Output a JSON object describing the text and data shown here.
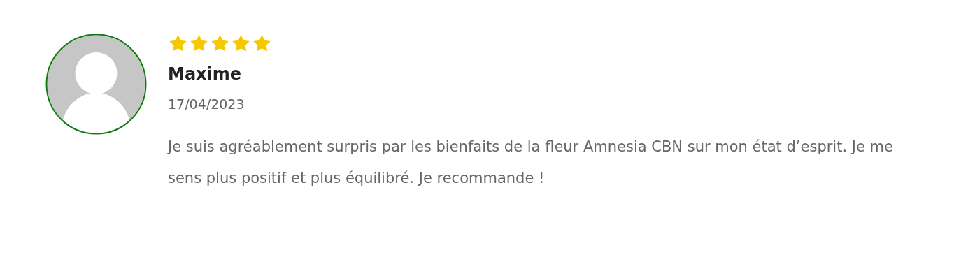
{
  "review": {
    "stars": 5,
    "author": "Maxime",
    "date": "17/04/2023",
    "text": "Je suis agréablement surpris par les bienfaits de la fleur Amnesia CBN sur mon état d’esprit. Je me sens plus positif et plus équilibré. Je recommande !"
  }
}
